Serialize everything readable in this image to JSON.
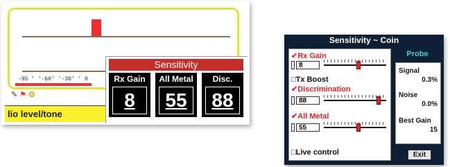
{
  "main_screen": {
    "scale_text": "-95 ' '-60' '-30' ' 0",
    "status_text": "lio level/tone",
    "sensitivity": {
      "title": "Sensitivity",
      "columns": [
        {
          "label": "Rx Gain",
          "value": "8"
        },
        {
          "label": "All Metal",
          "value": "55"
        },
        {
          "label": "Disc.",
          "value": "88"
        }
      ]
    }
  },
  "dialog": {
    "title": "Sensitivity ~ Coin",
    "rx_gain": {
      "label": "✔Rx Gain",
      "value": "8",
      "slider_level": 0.55
    },
    "tx_boost": {
      "label": "□Tx Boost"
    },
    "discrimination": {
      "label": "✔Discrimination",
      "value": "88",
      "slider_level": 0.88
    },
    "all_metal": {
      "label": "✔All Metal",
      "value": "55",
      "slider_level": 0.55
    },
    "live_control": {
      "label": "□Live control"
    },
    "probe": {
      "title": "Probe",
      "signal_label": "Signal",
      "signal_value": "0.3%",
      "noise_label": "Noise",
      "noise_value": "0.0%",
      "best_gain_label": "Best Gain",
      "best_gain_value": "15"
    },
    "exit_label": "Exit"
  }
}
